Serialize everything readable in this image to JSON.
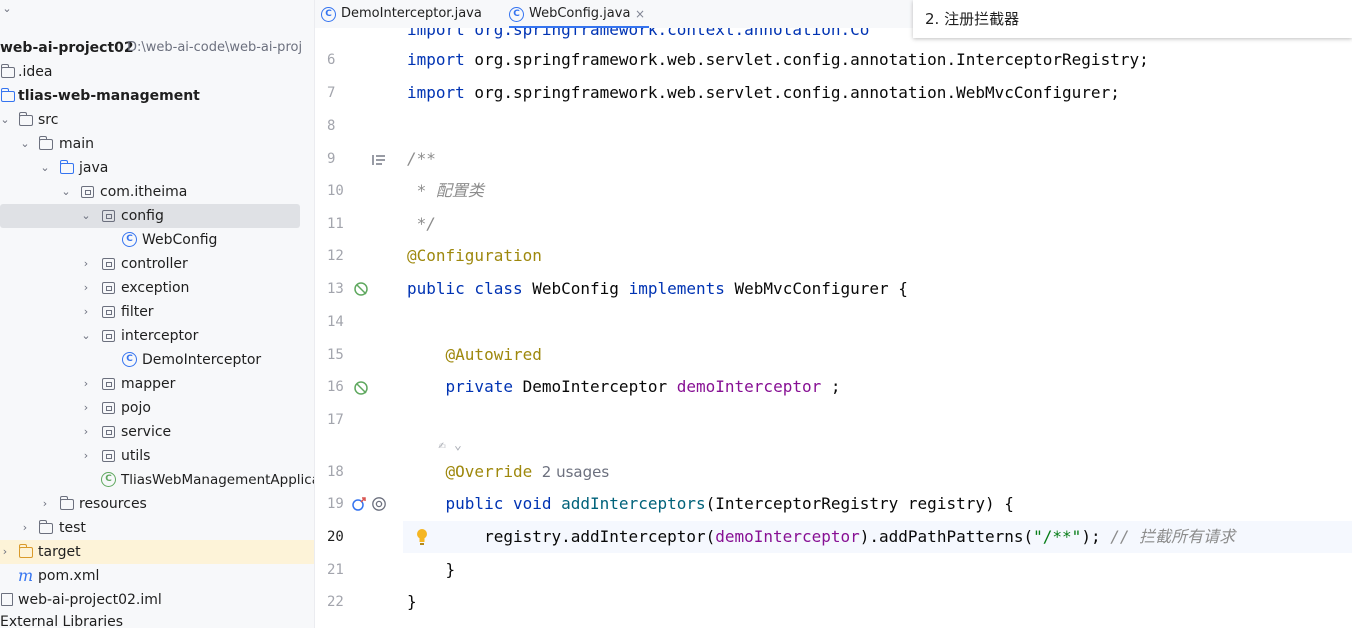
{
  "project": {
    "name": "web-ai-project02",
    "path": "D:\\web-ai-code\\web-ai-proj",
    "idea": ".idea",
    "module": "tlias-web-management",
    "src": "src",
    "main": "main",
    "java": "java",
    "package": "com.itheima",
    "config": "config",
    "webconfig": "WebConfig",
    "controller": "controller",
    "exception": "exception",
    "filter": "filter",
    "interceptor": "interceptor",
    "demointerceptor": "DemoInterceptor",
    "mapper": "mapper",
    "pojo": "pojo",
    "service": "service",
    "utils": "utils",
    "app": "TliasWebManagementApplica",
    "resources": "resources",
    "test": "test",
    "target": "target",
    "pom": "pom.xml",
    "iml": "web-ai-project02.iml",
    "external": "External Libraries"
  },
  "tabs": {
    "tab1": "DemoInterceptor.java",
    "tab2": "WebConfig.java",
    "close": "×"
  },
  "popup": {
    "text": "2. 注册拦截器"
  },
  "editor": {
    "lines": {
      "n6": "6",
      "n7": "7",
      "n8": "8",
      "n9": "9",
      "n10": "10",
      "n11": "11",
      "n12": "12",
      "n13": "13",
      "n14": "14",
      "n15": "15",
      "n16": "16",
      "n17": "17",
      "n18": "18",
      "n19": "19",
      "n20": "20",
      "n21": "21",
      "n22": "22"
    },
    "code": {
      "l5": "import org.springframework.context.annotation.Co",
      "l6_kw": "import",
      "l6_rest": " org.springframework.web.servlet.config.annotation.InterceptorRegistry;",
      "l7_kw": "import",
      "l7_rest": " org.springframework.web.servlet.config.annotation.WebMvcConfigurer;",
      "l9": "/**",
      "l10": " * 配置类",
      "l11": " */",
      "l12": "@Configuration",
      "l13_kw": "public class",
      "l13_a": " WebConfig ",
      "l13_kw2": "implements",
      "l13_b": " WebMvcConfigurer {",
      "l15": "    @Autowired",
      "l16_kw": "    private",
      "l16_a": " DemoInterceptor ",
      "l16_fld": "demoInterceptor",
      "l16_b": " ;",
      "ai_hint": "    ✍ ⌄",
      "l18_ann": "    @Override",
      "l18_hint": "  2 usages",
      "l19_kw": "    public void",
      "l19_meth": " addInterceptors",
      "l19_b": "(InterceptorRegistry registry) {",
      "l20_a": "        registry.addInterceptor(",
      "l20_fld": "demoInterceptor",
      "l20_b": ").addPathPatterns(",
      "l20_str": "\"/**\"",
      "l20_c": "); ",
      "l20_cmt": "// 拦截所有请求",
      "l21": "    }",
      "l22": "}"
    }
  },
  "colors": {
    "accent": "#3574f0",
    "keyword": "#0033b3",
    "annotation": "#9e880d",
    "field": "#871094",
    "string": "#067d17",
    "comment": "#8c8c8c"
  }
}
